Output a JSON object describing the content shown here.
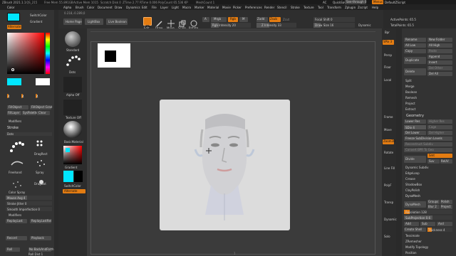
{
  "titlebar": {
    "app": "ZBrush 2021.1.1",
    "stats": [
      "QS_215",
      "Free Mem 55.891GB",
      "Active Mem 1015",
      "Scratch Disk 0",
      "ZTime 2.77 RTime 0.006",
      "PolyCount 65.536 KP",
      "MeshCount 1"
    ],
    "right": [
      "AC",
      "QuickSave",
      "See-through 0",
      "Menus",
      "DefaultZScript"
    ]
  },
  "menubar": [
    "Alpha",
    "Brush",
    "Color",
    "Document",
    "Draw",
    "Dynamics",
    "Edit",
    "File",
    "Layer",
    "Light",
    "Macro",
    "Marker",
    "Material",
    "Movie",
    "Picker",
    "Preferences",
    "Render",
    "Stencil",
    "Stroke",
    "Texture",
    "Tool",
    "Transform",
    "Zplugin",
    "Zscript",
    "Help"
  ],
  "leftpanel": {
    "color_title": "Color",
    "switch_color": "SwitchColor",
    "gradient": "Gradient",
    "alternate": "Alternate",
    "values": [
      "4",
      "4",
      "4"
    ],
    "buttons": [
      "FillObject",
      "FillObject Grad",
      "FillLayer",
      "SysPalette",
      "Clear"
    ],
    "modifiers": "Modifiers",
    "stroke_title": "Stroke",
    "dots": "Dots",
    "strokes": [
      "DragRect",
      "Freehand",
      "Spray",
      "DragDot",
      "Color Spray",
      "Colorized Spray"
    ],
    "mouse_avg": "Mouse Avg 4",
    "stroke_jitter": "Stroke Jitter 0",
    "smooth_imperfection": "Smooth Imperfection 0",
    "modifiers2": "Modifiers",
    "replay_last": "ReplayLast",
    "replay_last_rel": "ReplayLastRel",
    "record": "Record",
    "playback": "Playback",
    "roll": "Roll",
    "no_backforth": "No BackAndForth",
    "roll_dist": "Roll Dist 1"
  },
  "shelf": {
    "home": "Home Page",
    "lightbox": "LightBox",
    "live_boolean": "Live Boolean",
    "coords": "0.218,-0.289,0",
    "tools": [
      "Edit",
      "Draw",
      "Move",
      "Scale",
      "Rotate"
    ],
    "mrgb": "Mrgb",
    "rgb": "Rgb",
    "m": "M",
    "zadd": "Zadd",
    "zsub": "Zsub",
    "zcut": "Zcut",
    "rgb_intensity": "Rgb Intensity 20",
    "z_intensity": "Z Intensity 33",
    "focal_shift": "Focal Shift 0",
    "draw_size": "Draw Size 16",
    "dynamic": "Dynamic",
    "active_points": "ActivePoints: 65.5",
    "total_points": "TotalPoints: 65.5"
  },
  "leftshelf": {
    "items": [
      "Standard",
      "Dots",
      "Alpha Off",
      "Texture Off",
      "BasicMaterial",
      "Gradient",
      "SwitchColor",
      "Alternate"
    ]
  },
  "rightbar": [
    "Bpr",
    "SPix 3",
    "Persp",
    "Floor",
    "Local",
    "Frame",
    "Move",
    "Zoom3D",
    "Rotate",
    "Line Fill",
    "PolyF",
    "Transp",
    "Dynamic",
    "Solo"
  ],
  "rightpanel": {
    "top": [
      "Rename",
      "New Folder",
      "All Low",
      "All High",
      "Copy",
      "Paste",
      "Duplicate",
      "Append",
      "Insert",
      "Delete",
      "Del Other",
      "Del All",
      "Split",
      "Merge",
      "Boolean",
      "Remesh",
      "Project",
      "Extract"
    ],
    "geometry": "Geometry",
    "lower_res": "Lower Res",
    "higher_res": "Higher Res",
    "sdiv": "SDiv 4",
    "cage": "Cage",
    "del_lower": "Del Lower",
    "del_higher": "Del Higher",
    "freeze": "Freeze SubDivision Levels",
    "reconstruct": "Reconstruct Subdiv",
    "convert_bpr": "Convert BPR To Geo",
    "divide": "Divide",
    "smt": "Smt",
    "suv": "Suv",
    "reuv": "ReUV",
    "dynamic_subdiv": "Dynamic Subdiv",
    "edgeloop": "EdgeLoop",
    "crease": "Crease",
    "shadowbox": "ShadowBox",
    "claypolish": "ClayPolish",
    "dynamesh_section": "DynaMesh",
    "dynamesh": "DynaMesh",
    "groups": "Groups",
    "polish": "Polish",
    "blur": "Blur 2",
    "project": "Project",
    "resolution": "Resolution 128",
    "subprojection": "SubProjection 0.6",
    "add": "Add",
    "sub": "Sub",
    "and": "And",
    "create_shell": "Create Shell",
    "thickness": "Thickness 4",
    "tessimate": "Tessimate",
    "zremesher": "ZRemesher",
    "modify_topology": "Modify Topology",
    "position": "Position"
  },
  "canvas": {
    "bottom_label": "1"
  },
  "colors": {
    "accent": "#e37c12",
    "bg": "#2a2a2a",
    "panel": "#333333",
    "button": "#4a4a4a"
  }
}
